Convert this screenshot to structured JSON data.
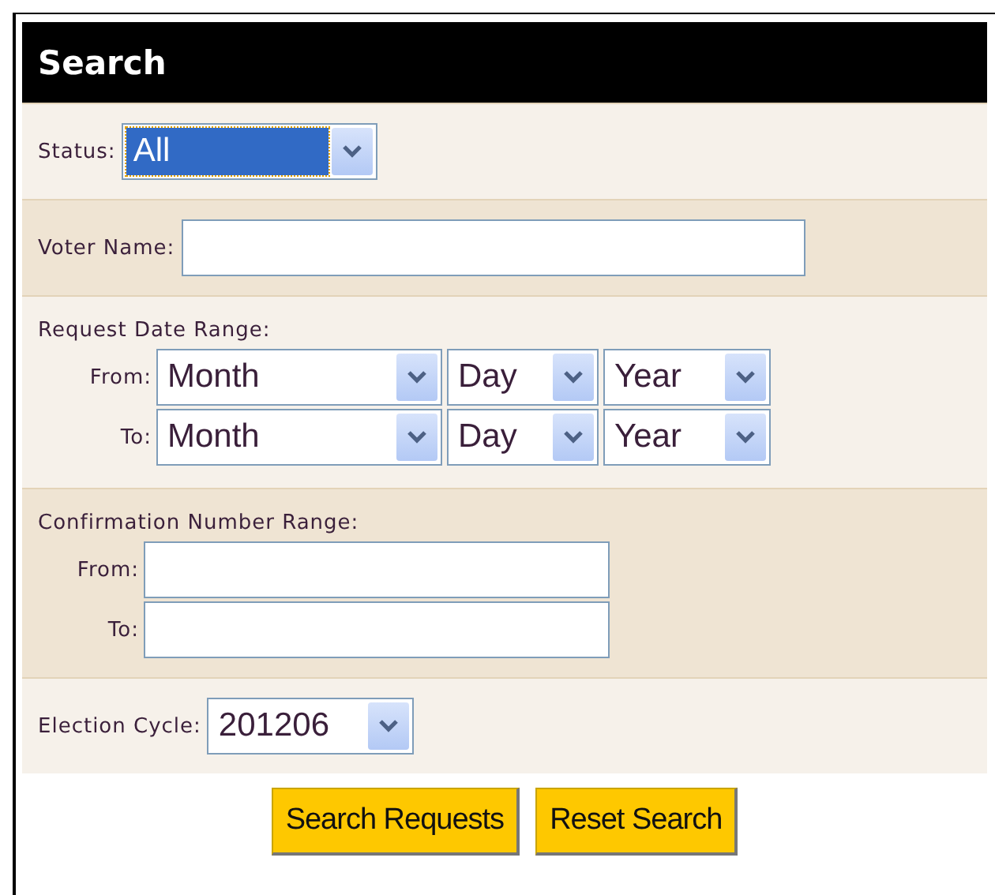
{
  "panel": {
    "title": "Search"
  },
  "sections": [
    {
      "kind": "select",
      "label": "Status:",
      "value": "All",
      "focused": true
    },
    {
      "kind": "text",
      "label": "Voter Name:"
    },
    {
      "kind": "date_range",
      "label": "Request Date Range:",
      "rows": [
        {
          "label": "From:",
          "month": "Month",
          "day": "Day",
          "year": "Year"
        },
        {
          "label": "To:",
          "month": "Month",
          "day": "Day",
          "year": "Year"
        }
      ]
    },
    {
      "kind": "number_range",
      "label": "Confirmation Number Range:",
      "rows": [
        {
          "label": "From:"
        },
        {
          "label": "To:"
        }
      ]
    },
    {
      "kind": "select",
      "label": "Election Cycle:",
      "value": "201206",
      "focused": false
    }
  ],
  "buttons": [
    "Search Requests",
    "Reset Search"
  ]
}
